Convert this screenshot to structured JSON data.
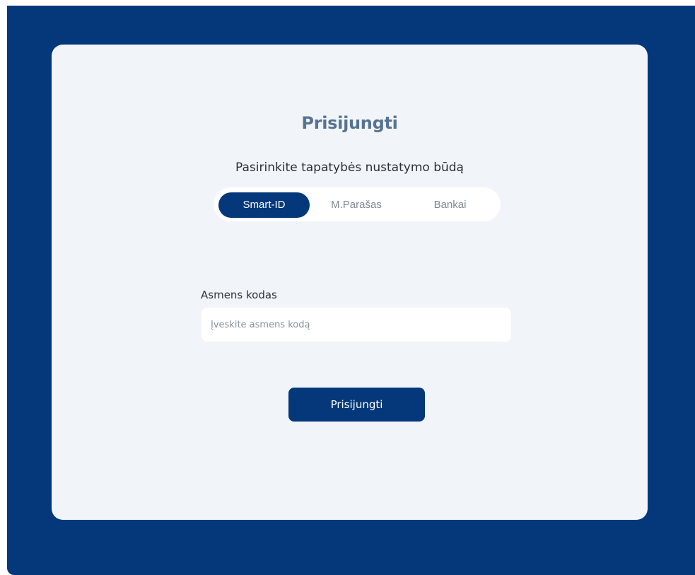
{
  "login": {
    "title": "Prisijungti",
    "subtitle": "Pasirinkite tapatybės nustatymo būdą",
    "tabs": [
      {
        "label": "Smart-ID",
        "active": true
      },
      {
        "label": "M.Parašas",
        "active": false
      },
      {
        "label": "Bankai",
        "active": false
      }
    ],
    "personal_code": {
      "label": "Asmens kodas",
      "value": "",
      "placeholder": "Įveskite asmens kodą"
    },
    "submit_label": "Prisijungti"
  },
  "colors": {
    "frame": "#04387a",
    "card": "#f1f5fa",
    "title": "#567391",
    "accent": "#04387a"
  }
}
